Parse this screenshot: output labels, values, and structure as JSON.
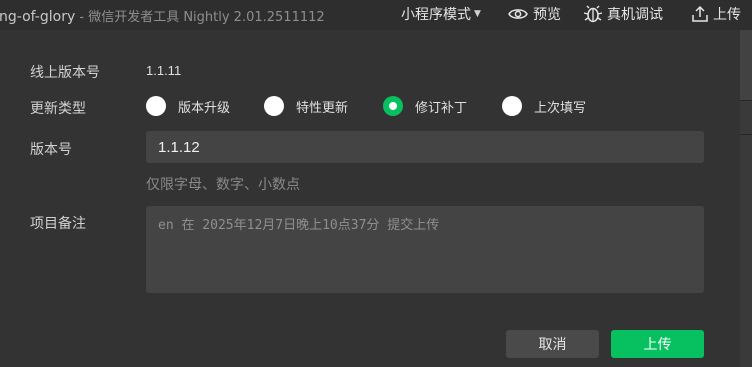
{
  "titlebar": {
    "project_name": "ng-of-glory",
    "app_subtitle": " - 微信开发者工具 Nightly 2.01.2511112",
    "mode_label": "小程序模式",
    "preview_label": "预览",
    "debug_label": "真机调试",
    "upload_label": "上传"
  },
  "form": {
    "online_version_label": "线上版本号",
    "online_version_value": "1.1.11",
    "update_type_label": "更新类型",
    "update_types": [
      {
        "label": "版本升级",
        "checked": false
      },
      {
        "label": "特性更新",
        "checked": false
      },
      {
        "label": "修订补丁",
        "checked": true
      },
      {
        "label": "上次填写",
        "checked": false
      }
    ],
    "version_label": "版本号",
    "version_value": "1.1.12",
    "version_hint": "仅限字母、数字、小数点",
    "notes_label": "项目备注",
    "notes_placeholder": "en 在 2025年12月7日晚上10点37分 提交上传"
  },
  "actions": {
    "cancel_label": "取消",
    "upload_label": "上传"
  },
  "colors": {
    "accent": "#07c160",
    "background": "#333333",
    "input_bg": "#444444"
  }
}
